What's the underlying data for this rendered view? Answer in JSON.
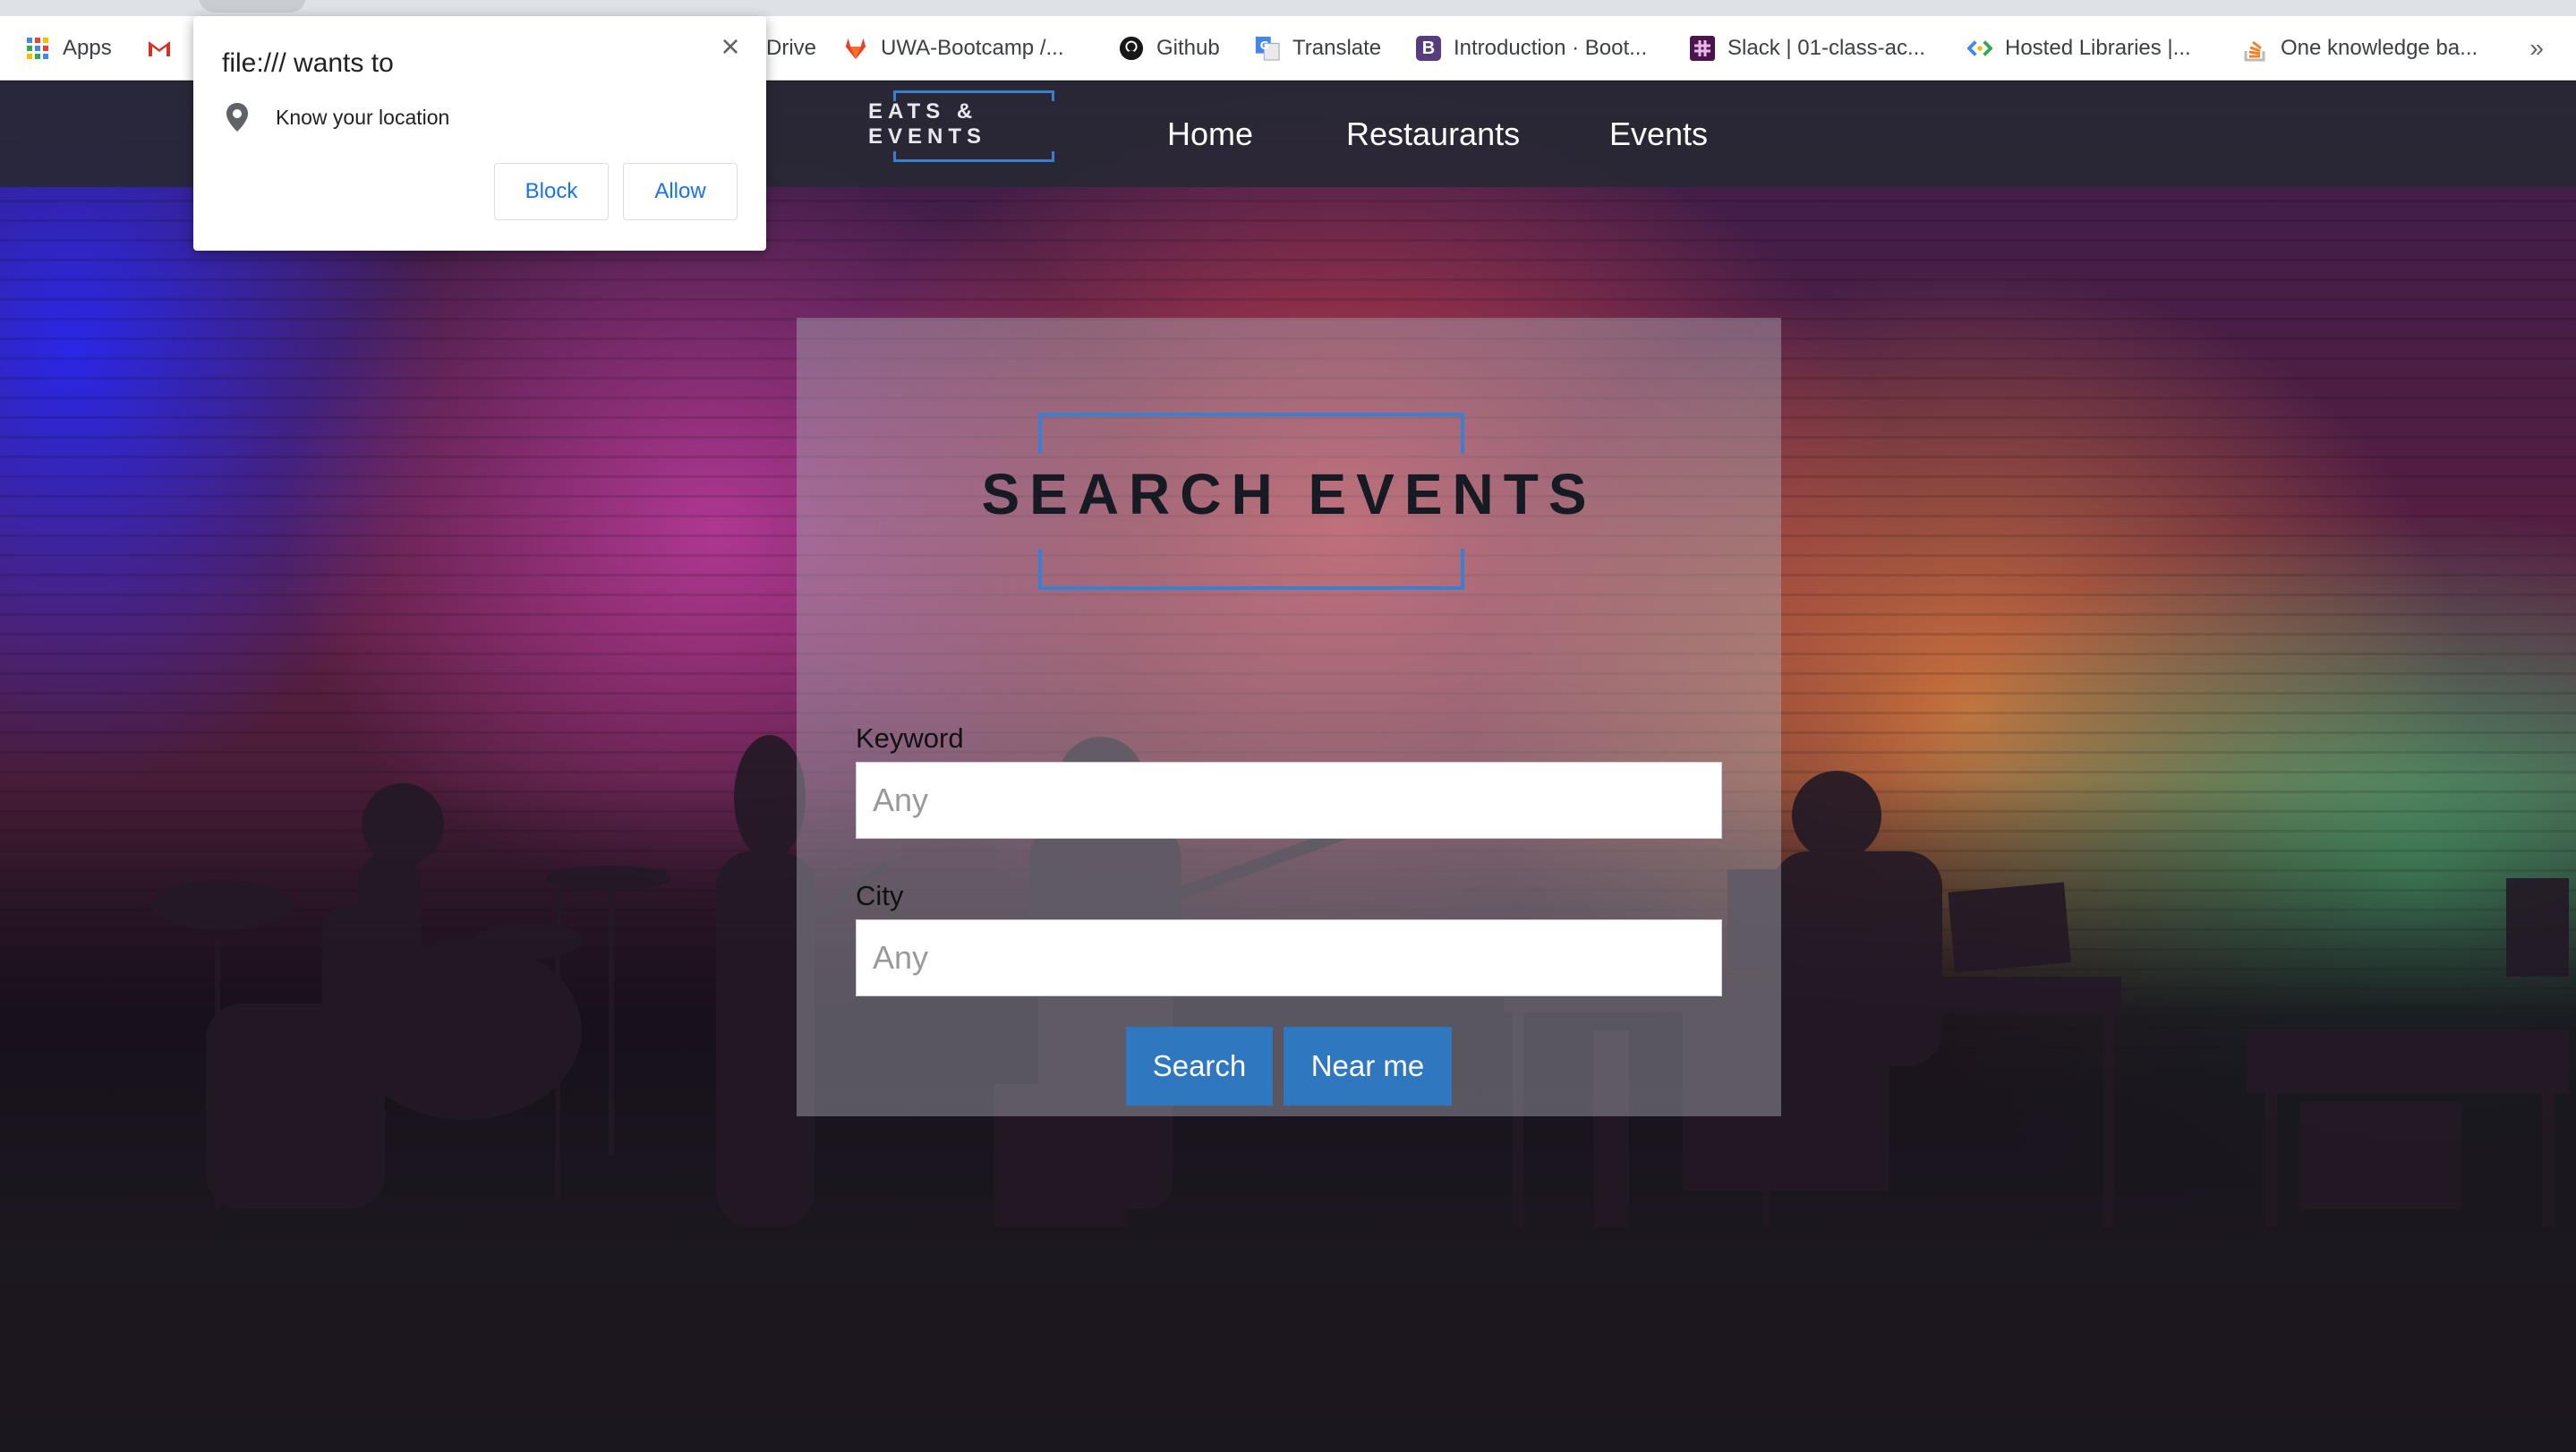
{
  "bookmarks": [
    {
      "label": "Apps",
      "icon": "apps-grid-icon",
      "color": "#4285f4"
    },
    {
      "label": "",
      "icon": "gmail-icon",
      "color": "#d93025"
    },
    {
      "label": "Drive",
      "icon": "",
      "color": ""
    },
    {
      "label": "UWA-Bootcamp /...",
      "icon": "gitlab-icon",
      "color": "#e2432a"
    },
    {
      "label": "Github",
      "icon": "github-icon",
      "color": "#181717"
    },
    {
      "label": "Translate",
      "icon": "translate-icon",
      "color": "#4285f4"
    },
    {
      "label": "Introduction · Boot...",
      "icon": "bootstrap-icon",
      "color": "#563d7c"
    },
    {
      "label": "Slack | 01-class-ac...",
      "icon": "slack-icon",
      "color": "#4a154b"
    },
    {
      "label": "Hosted Libraries |...",
      "icon": "hosted-libraries-icon",
      "color": "#34a853"
    },
    {
      "label": "One knowledge ba...",
      "icon": "stackoverflow-icon",
      "color": "#f48024"
    }
  ],
  "bookmarks_overflow": "»",
  "nav": {
    "brand": "EATS & EVENTS",
    "links": [
      "Home",
      "Restaurants",
      "Events"
    ]
  },
  "search": {
    "logo_text": "SEARCH EVENTS",
    "keyword_label": "Keyword",
    "keyword_placeholder": "Any",
    "city_label": "City",
    "city_placeholder": "Any",
    "search_button": "Search",
    "near_me_button": "Near me"
  },
  "permission_popup": {
    "title": "file:/// wants to",
    "permission": "Know your location",
    "block_label": "Block",
    "allow_label": "Allow",
    "close_glyph": "×"
  },
  "colors": {
    "accent_blue": "#2f78c0",
    "frame_blue": "#3a7fd0",
    "popup_link": "#1a73e8"
  }
}
